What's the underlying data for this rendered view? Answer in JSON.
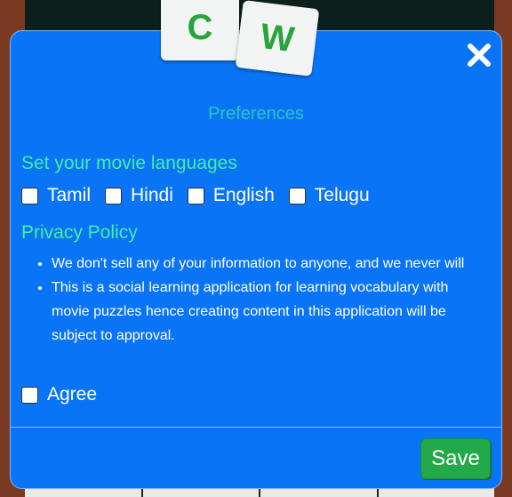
{
  "logo": {
    "tiles": [
      "C",
      "W"
    ]
  },
  "modal": {
    "title": "Preferences",
    "close_icon": "close-icon",
    "languages": {
      "heading": "Set your movie languages",
      "options": [
        {
          "label": "Tamil",
          "checked": false
        },
        {
          "label": "Hindi",
          "checked": false
        },
        {
          "label": "English",
          "checked": false
        },
        {
          "label": "Telugu",
          "checked": false
        }
      ]
    },
    "privacy": {
      "heading": "Privacy Policy",
      "points": [
        "We don't sell any of your information to anyone, and we never will",
        "This is a social learning application for learning vocabulary with movie puzzles hence creating content in this application will be subject to approval."
      ]
    },
    "agree": {
      "label": "Agree",
      "checked": false
    },
    "save_label": "Save"
  },
  "colors": {
    "modal_bg": "#0a74f7",
    "title": "#2ec4c0",
    "heading": "#41f0a7",
    "save_button": "#22a94a",
    "logo_letters": "#27a53a"
  }
}
